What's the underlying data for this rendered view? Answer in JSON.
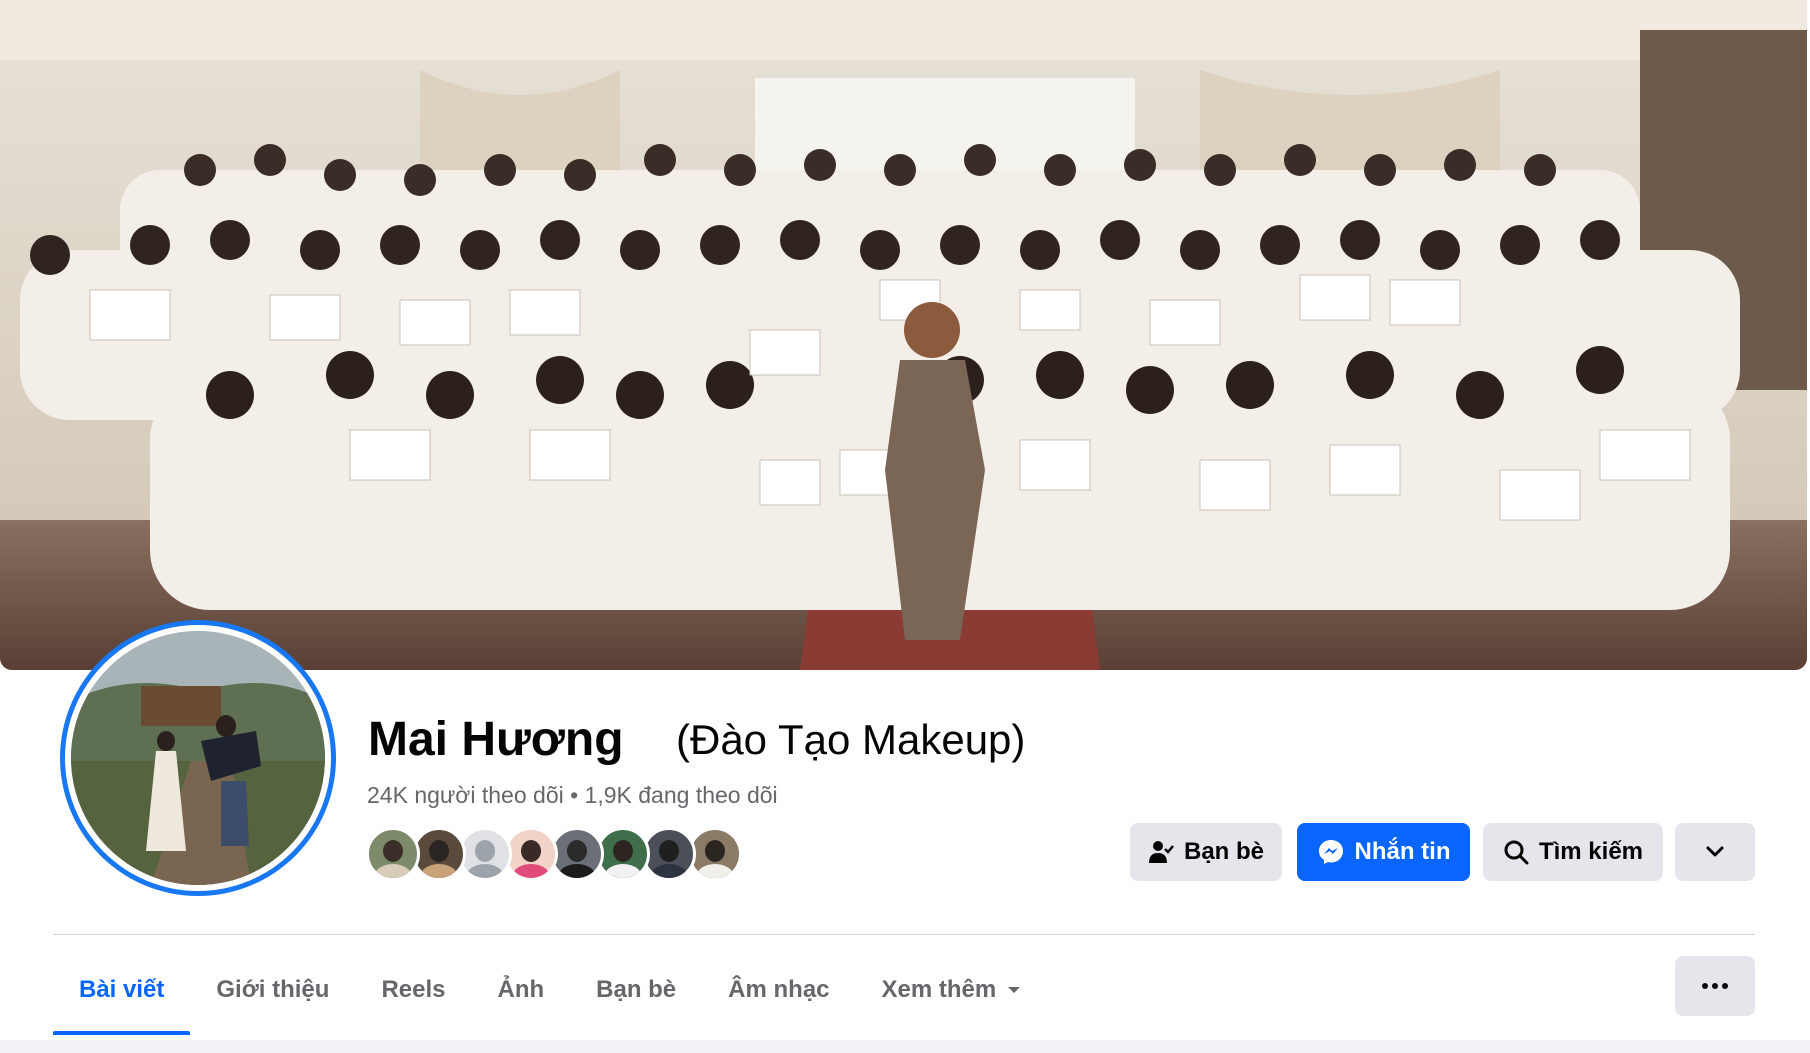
{
  "profile": {
    "name": "Mai Hương",
    "alternate_name": "(Đào Tạo Makeup)",
    "stats": "24K người theo dõi • 1,9K đang theo dõi"
  },
  "friend_avatars": [
    {
      "head": "#3b2f2a",
      "body": "#d8cbb8",
      "bg": "#7d8b6a"
    },
    {
      "head": "#2a2522",
      "body": "#c8a37a",
      "bg": "#5a4a3c"
    },
    {
      "head": "#9da3aa",
      "body": "#9da3aa",
      "bg": "#dfe1e4"
    },
    {
      "head": "#3a2a26",
      "body": "#e04b7a",
      "bg": "#f2d3c7"
    },
    {
      "head": "#2b2b2b",
      "body": "#1c1c1c",
      "bg": "#6a6f78"
    },
    {
      "head": "#2d2620",
      "body": "#f2f2f2",
      "bg": "#3f6e4a"
    },
    {
      "head": "#1f1f1f",
      "body": "#2d3340",
      "bg": "#4b4f57"
    },
    {
      "head": "#2b2520",
      "body": "#f1efe9",
      "bg": "#8a7a66"
    }
  ],
  "actions": {
    "friends_label": "Bạn bè",
    "message_label": "Nhắn tin",
    "search_label": "Tìm kiếm"
  },
  "tabs": [
    {
      "label": "Bài viết",
      "active": true
    },
    {
      "label": "Giới thiệu",
      "active": false
    },
    {
      "label": "Reels",
      "active": false
    },
    {
      "label": "Ảnh",
      "active": false
    },
    {
      "label": "Bạn bè",
      "active": false
    },
    {
      "label": "Âm nhạc",
      "active": false
    },
    {
      "label": "Xem thêm",
      "active": false
    }
  ],
  "colors": {
    "accent": "#0866ff",
    "secondary_text": "#65676b",
    "button_gray": "#e4e6eb"
  }
}
